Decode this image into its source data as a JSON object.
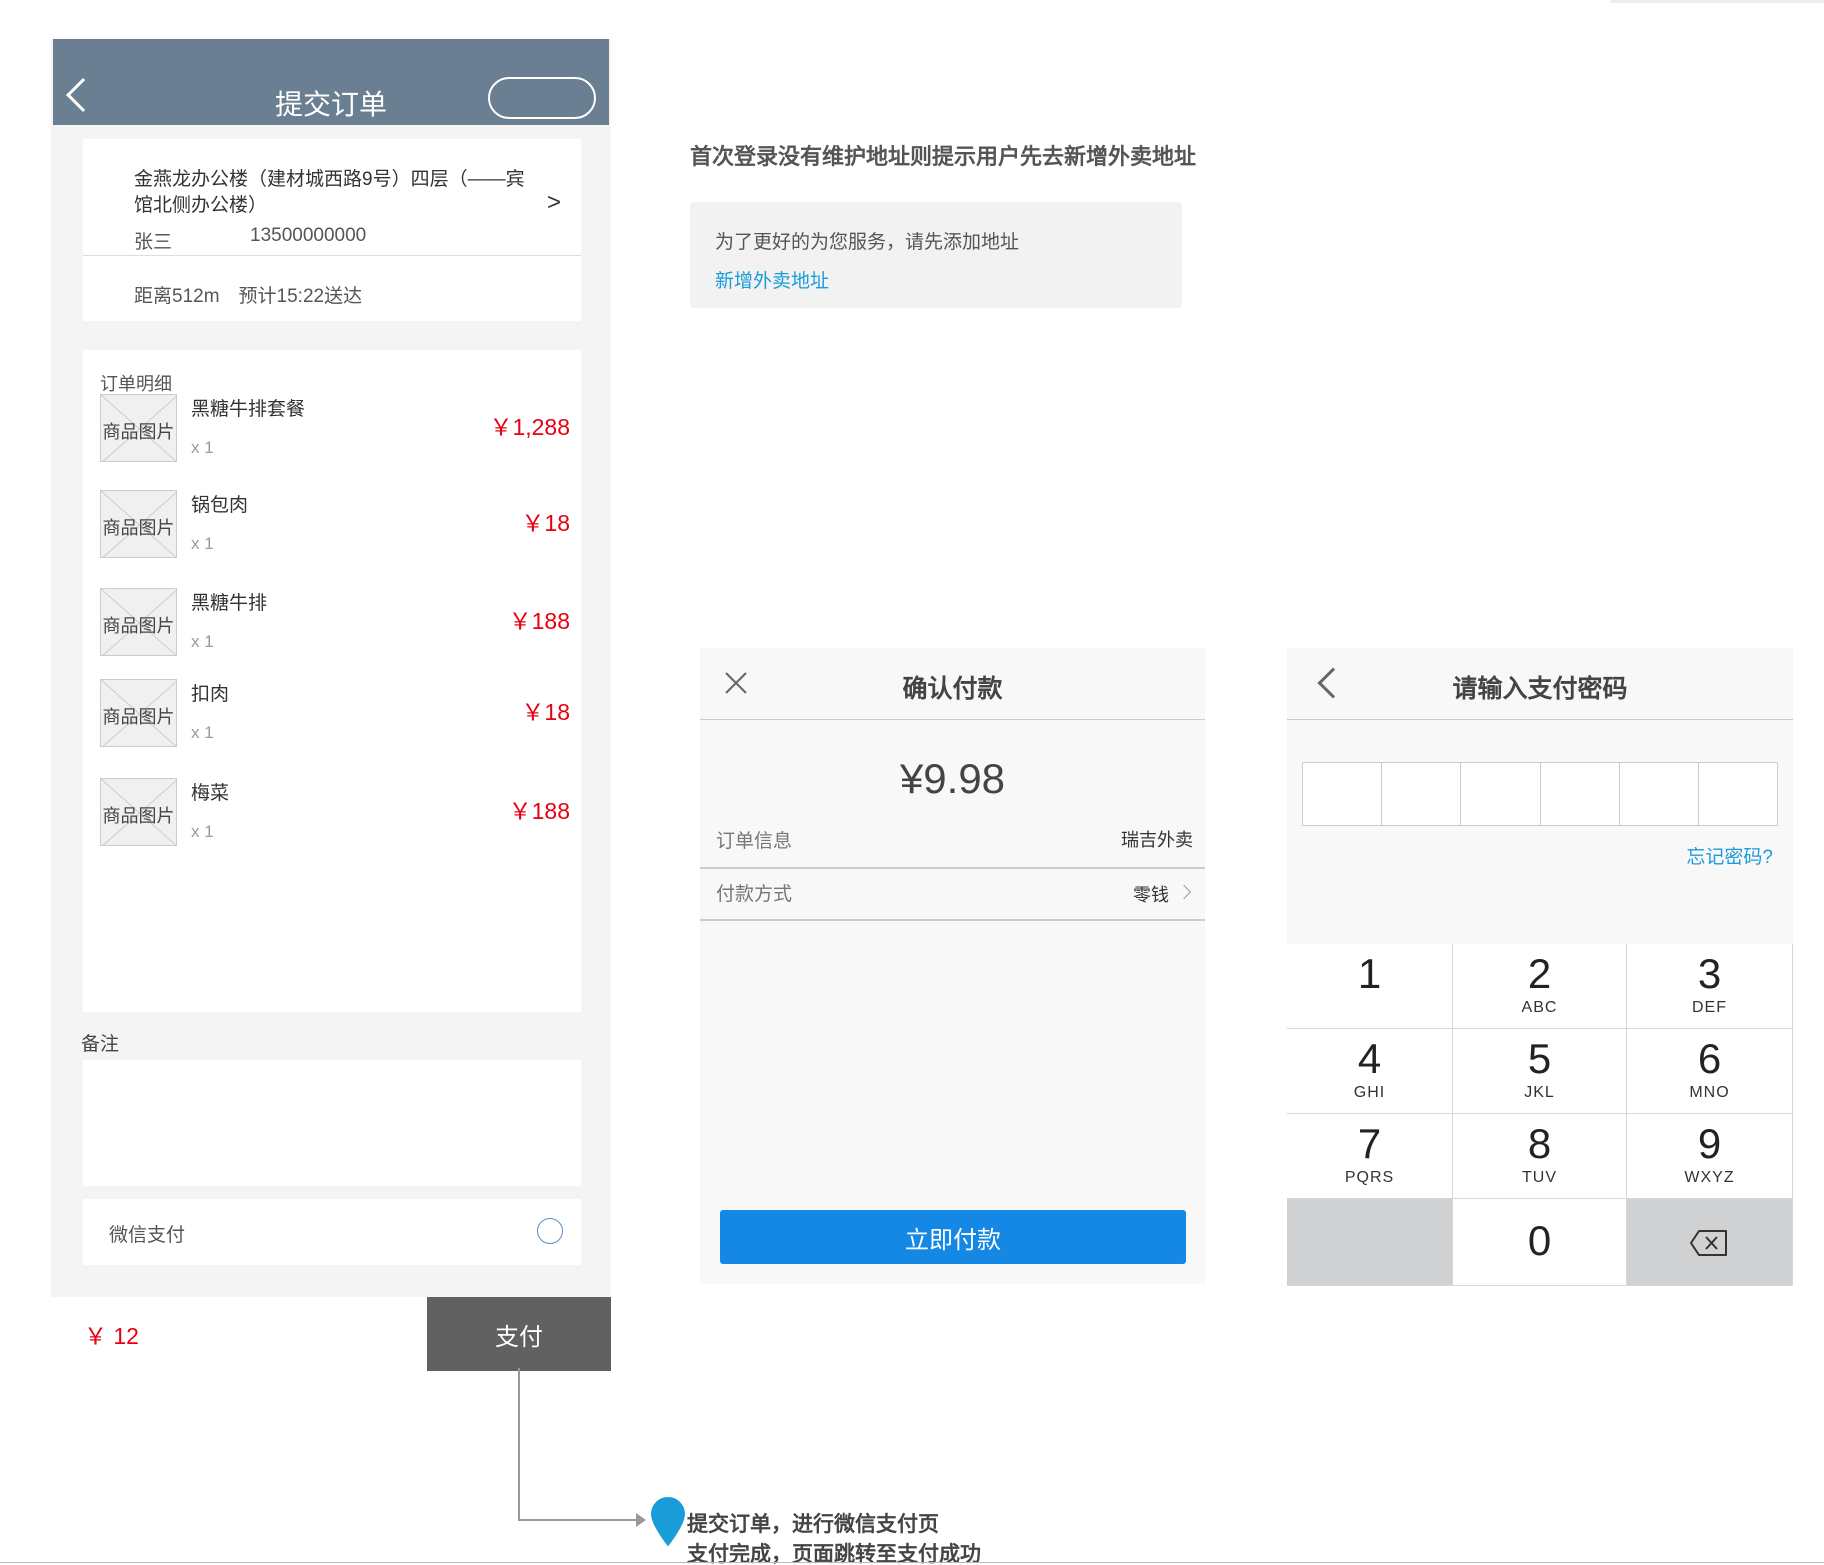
{
  "submit_order": {
    "title": "提交订单",
    "address": {
      "line": "金燕龙办公楼（建材城西路9号）四层（——宾馆北侧办公楼）",
      "arrow": ">",
      "name": "张三",
      "phone": "13500000000",
      "distance": "距离512m　预计15:22送达"
    },
    "order_detail_title": "订单明细",
    "items": [
      {
        "thumb": "商品图片",
        "name": "黑糖牛排套餐",
        "qty": "x 1",
        "price": "￥1,288"
      },
      {
        "thumb": "商品图片",
        "name": "锅包肉",
        "qty": "x 1",
        "price": "￥18"
      },
      {
        "thumb": "商品图片",
        "name": "黑糖牛排",
        "qty": "x 1",
        "price": "￥188"
      },
      {
        "thumb": "商品图片",
        "name": "扣肉",
        "qty": "x 1",
        "price": "￥18"
      },
      {
        "thumb": "商品图片",
        "name": "梅菜",
        "qty": "x 1",
        "price": "￥188"
      }
    ],
    "note_label": "备注",
    "payment_option": "微信支付",
    "total": "￥ 12",
    "pay_label": "支付"
  },
  "annotation": {
    "heading": "首次登录没有维护地址则提示用户先去新增外卖地址",
    "tip_text": "为了更好的为您服务，请先添加地址",
    "tip_link": "新增外卖地址"
  },
  "confirm_payment": {
    "title": "确认付款",
    "amount": "¥9.98",
    "info_label": "订单信息",
    "info_value": "瑞吉外卖",
    "method_label": "付款方式",
    "method_value": "零钱",
    "pay_now_label": "立即付款"
  },
  "password_entry": {
    "title": "请输入支付密码",
    "forgot_label": "忘记密码?",
    "keys": [
      {
        "num": "1",
        "letters": ""
      },
      {
        "num": "2",
        "letters": "ABC"
      },
      {
        "num": "3",
        "letters": "DEF"
      },
      {
        "num": "4",
        "letters": "GHI"
      },
      {
        "num": "5",
        "letters": "JKL"
      },
      {
        "num": "6",
        "letters": "MNO"
      },
      {
        "num": "7",
        "letters": "PQRS"
      },
      {
        "num": "8",
        "letters": "TUV"
      },
      {
        "num": "9",
        "letters": "WXYZ"
      },
      {
        "num": "0",
        "letters": ""
      }
    ]
  },
  "flow_note": {
    "line1": "提交订单，进行微信支付页",
    "line2": "支付完成，页面跳转至支付成功"
  },
  "colors": {
    "topbar": "#6b7f92",
    "price_red": "#e60012",
    "pay_button_gray": "#616161",
    "link_blue": "#1a9cd8",
    "pay_now_blue": "#1588e6",
    "pin_blue": "#1a9cd8"
  }
}
